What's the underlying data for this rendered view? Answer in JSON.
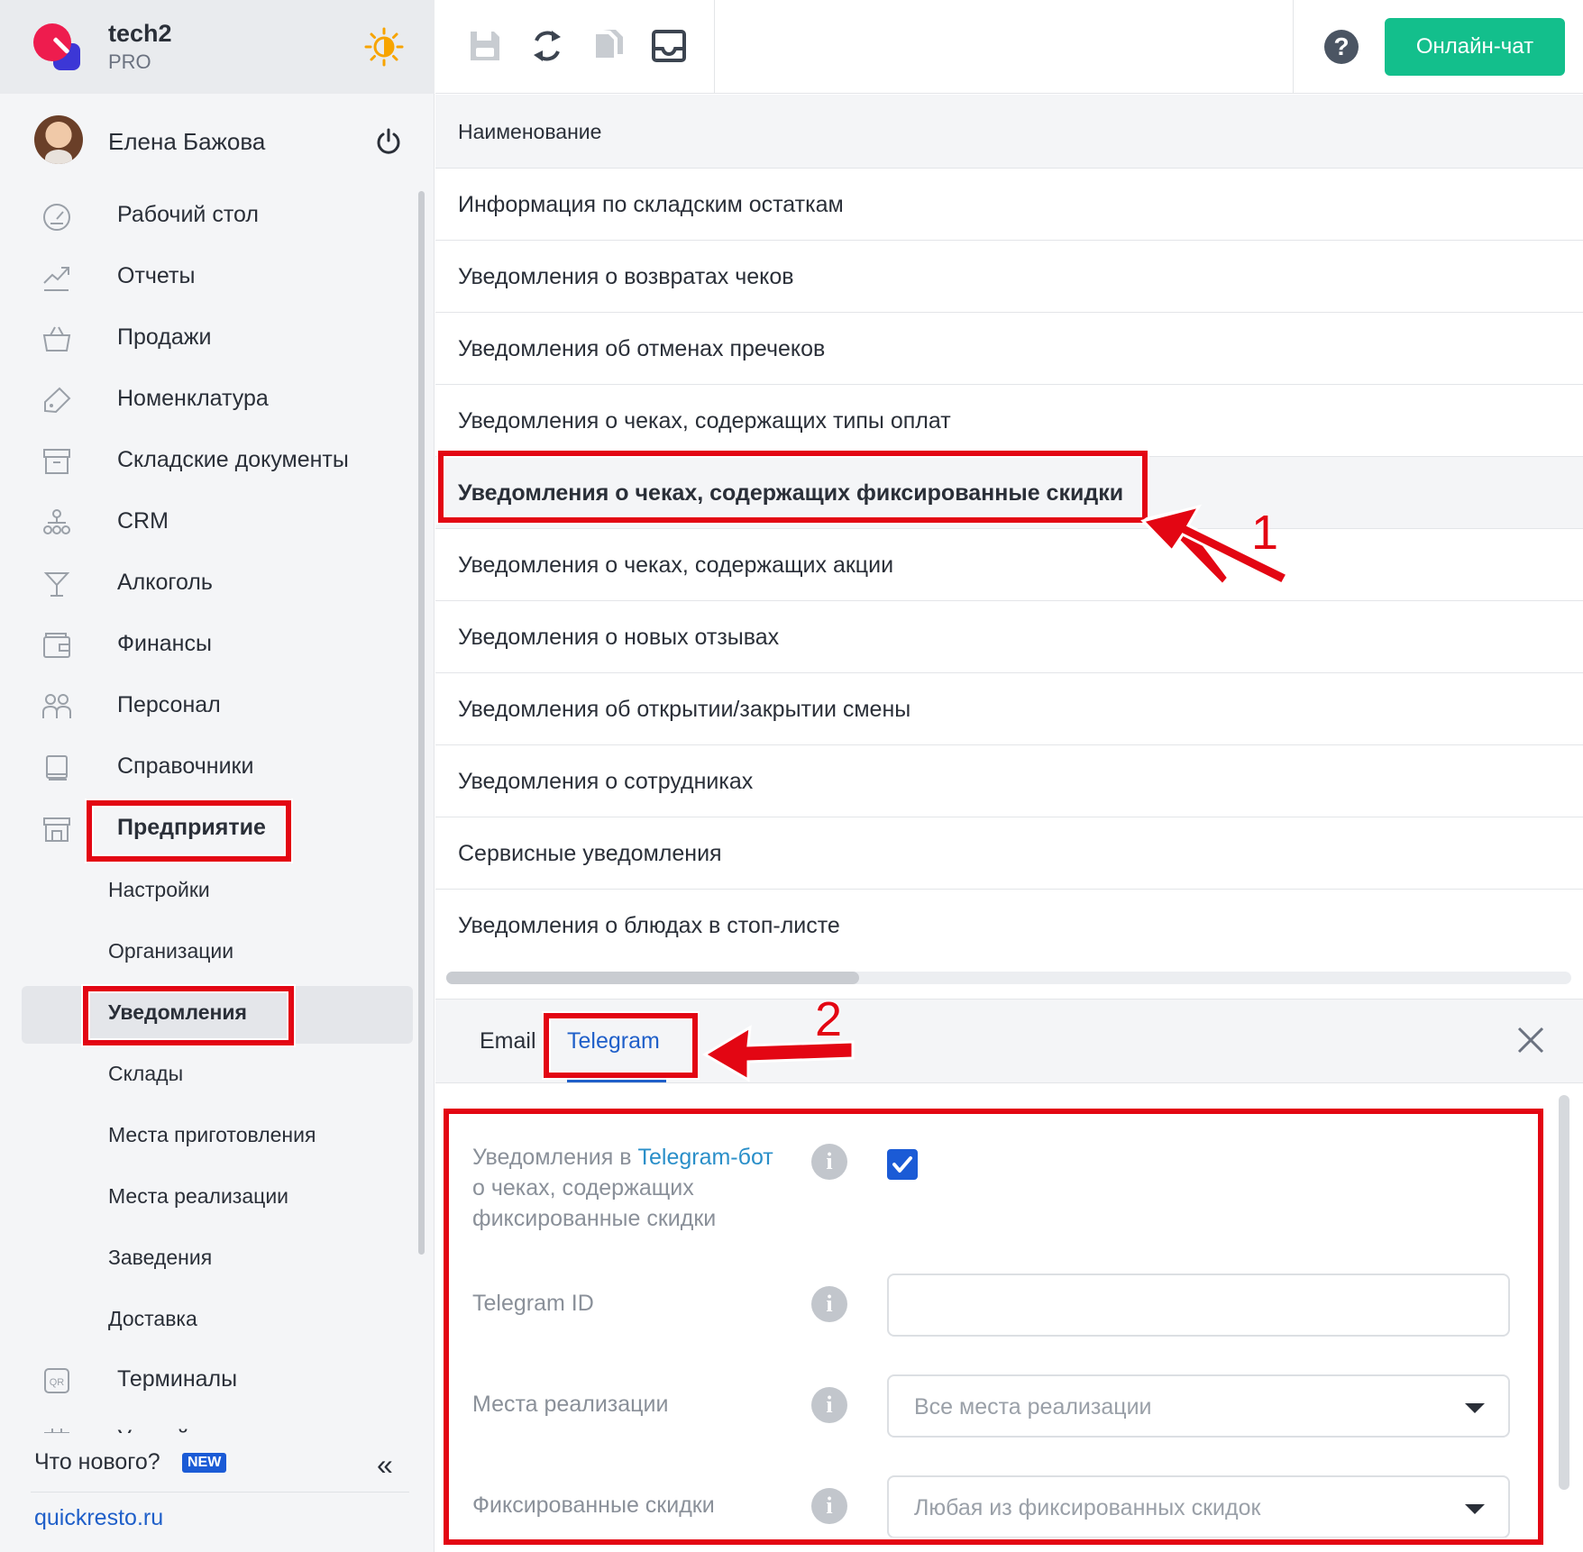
{
  "brand": {
    "name": "tech2",
    "plan": "PRO"
  },
  "user": {
    "name": "Елена Бажова"
  },
  "sidebar": {
    "items": [
      {
        "label": "Рабочий стол",
        "icon": "dashboard-icon"
      },
      {
        "label": "Отчеты",
        "icon": "chart-icon"
      },
      {
        "label": "Продажи",
        "icon": "basket-icon"
      },
      {
        "label": "Номенклатура",
        "icon": "tag-icon"
      },
      {
        "label": "Складские документы",
        "icon": "archive-icon"
      },
      {
        "label": "CRM",
        "icon": "crm-icon"
      },
      {
        "label": "Алкоголь",
        "icon": "cocktail-icon"
      },
      {
        "label": "Финансы",
        "icon": "wallet-icon"
      },
      {
        "label": "Персонал",
        "icon": "people-icon"
      },
      {
        "label": "Справочники",
        "icon": "book-icon"
      },
      {
        "label": "Предприятие",
        "icon": "store-icon"
      }
    ],
    "subitems": [
      "Настройки",
      "Организации",
      "Уведомления",
      "Склады",
      "Места приготовления",
      "Места реализации",
      "Заведения",
      "Доставка"
    ],
    "after": [
      {
        "label": "Терминалы",
        "icon": "qr-icon"
      },
      {
        "label": "Устройства",
        "icon": "device-icon"
      }
    ],
    "whats_new": "Что нового?",
    "new_badge": "NEW",
    "site": "quickresto.ru"
  },
  "toolbar": {
    "chat_label": "Онлайн-чат",
    "help_label": "?"
  },
  "list": {
    "header": "Наименование",
    "rows": [
      "Информация по складским остаткам",
      "Уведомления о возвратах чеков",
      "Уведомления об отменах пречеков",
      "Уведомления о чеках, содержащих типы оплат",
      "Уведомления о чеках, содержащих фиксированные скидки",
      "Уведомления о чеках, содержащих акции",
      "Уведомления о новых отзывах",
      "Уведомления об открытии/закрытии смены",
      "Уведомления о сотрудниках",
      "Сервисные уведомления",
      "Уведомления о блюдах в стоп-листе"
    ],
    "selected_index": 4
  },
  "detail": {
    "tabs": [
      "Email",
      "Telegram"
    ],
    "active_tab": "Telegram",
    "form": {
      "notify_label_prefix": "Уведомления в ",
      "notify_label_link": "Telegram-бот",
      "notify_label_line2": "о чеках, содержащих",
      "notify_label_line3": "фиксированные скидки",
      "notify_checked": true,
      "telegram_id_label": "Telegram ID",
      "telegram_id_value": "",
      "places_label": "Места реализации",
      "places_value": "Все места реализации",
      "discounts_label": "Фиксированные скидки",
      "discounts_value": "Любая из фиксированных скидок"
    }
  },
  "annotations": {
    "n1": "1",
    "n2": "2",
    "color": "#e30613"
  },
  "colors": {
    "accent": "#1b5bd6",
    "chat": "#13bf8c",
    "link": "#2a8fc9"
  }
}
